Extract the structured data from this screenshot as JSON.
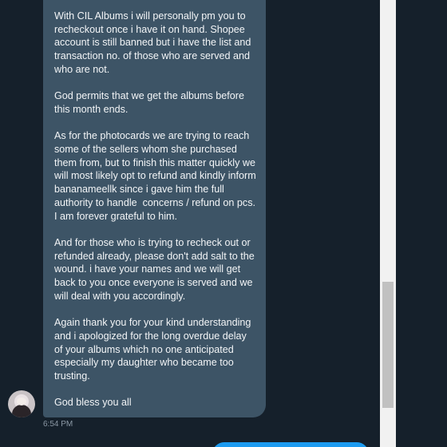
{
  "message": {
    "paragraphs": [
      "With CIL Albums i will personally pm you to recheckout once i have it on hand. Shopee account is still banned but i have the list and transaction no. of those who are served and who are not.",
      "God permits that we get the albums before this month ends.",
      "As for the photocards we are trying to reach some of the sellers whom she purchased them from, but to finish this matter quickly we will most likely opt to refund and kindly inform bananameellk since i gave him the full authority to handle  concerns / refund on pcs. I am forever grateful to him.",
      "And for those who is trying to recheck out or refunded already, please don't add salt to the wound. i have your names and we will get back to you once everyone is served and we will deal with you accordingly.",
      "Again thank you for your kind understanding and i apologized for the long overdue delay of your albums which no one anticipated especially my daughter who became too trusting.",
      "God bless you all"
    ],
    "timestamp": "6:54 PM"
  },
  "colors": {
    "background": "#15202b",
    "received_bubble": "#3d5466",
    "sent_bubble": "#1d9bf0",
    "scrollbar_track": "#f1f1f1",
    "scrollbar_thumb": "#c1c1c1"
  },
  "icons": {
    "avatar": "user-avatar-photo"
  }
}
